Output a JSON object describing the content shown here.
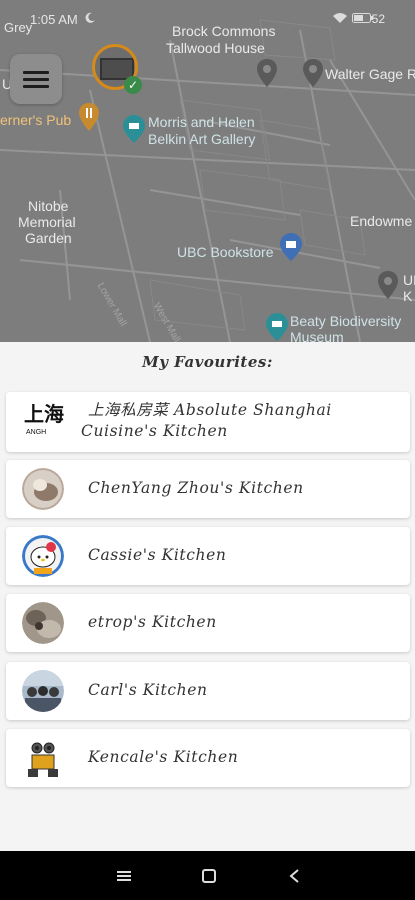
{
  "status_bar": {
    "time": "1:05 AM",
    "battery": "52",
    "carrier_fragment": "Grey"
  },
  "map": {
    "labels": {
      "brock": "Brock Commons",
      "tallwood": "Tallwood House",
      "walter": "Walter Gage R",
      "gardens": "U Gard",
      "pub": "erner's Pub",
      "morris1": "Morris and Helen",
      "morris2": "Belkin Art Gallery",
      "nitobe1": "Nitobe",
      "nitobe2": "Memorial",
      "nitobe3": "Garden",
      "endowment": "Endowme",
      "bookstore": "UBC Bookstore",
      "beaty1": "Beaty Biodiversity",
      "beaty2": "Museum",
      "ub1": "UB",
      "ub2": "K",
      "lower_mall": "Lower Mall",
      "west_mall": "West Mall"
    }
  },
  "favourites": {
    "title": "My Favourites:",
    "items": [
      {
        "name_cn": "上海私房菜",
        "name_line1": "Absolute Shanghai",
        "name_line2": "Cuisine's Kitchen"
      },
      {
        "name": "ChenYang Zhou's Kitchen"
      },
      {
        "name": "Cassie's Kitchen"
      },
      {
        "name": "etrop's Kitchen"
      },
      {
        "name": "Carl's Kitchen"
      },
      {
        "name": "Kencale's Kitchen"
      }
    ]
  },
  "logo_text": "上海",
  "logo_sub": "ANGH",
  "icons": [
    "menu-icon",
    "map-pin-icon",
    "museum-pin-icon",
    "pub-pin-icon",
    "store-pin-icon",
    "nav-recents-icon",
    "nav-home-icon",
    "nav-back-icon"
  ],
  "colors": {
    "map_overlay": "#7d7d7d",
    "marker_border": "#d58a19",
    "pin_teal": "#2a8f97",
    "card_bg": "#ffffff"
  }
}
